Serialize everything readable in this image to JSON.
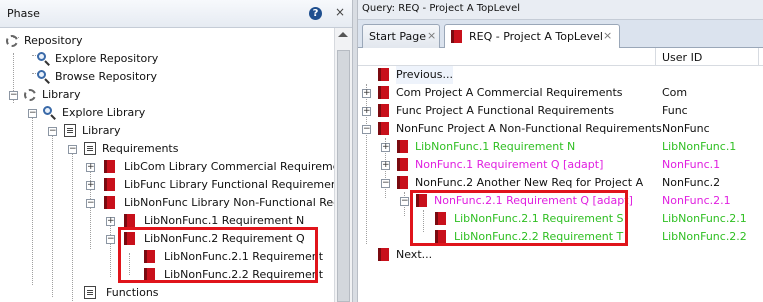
{
  "left_panel": {
    "title": "Phase",
    "help_icon": "?",
    "close_icon": "×",
    "tree": {
      "repository": "Repository",
      "explore_repository": "Explore Repository",
      "browse_repository": "Browse Repository",
      "library": "Library",
      "explore_library": "Explore Library",
      "library_doc": "Library",
      "requirements": "Requirements",
      "libcom": "LibCom Library Commercial Requirements",
      "libfunc": "LibFunc Library Functional Requirements",
      "libnonfunc": "LibNonFunc Library Non-Functional Requ",
      "libnonfunc1": "LibNonFunc.1 Requirement N",
      "libnonfunc2": "LibNonFunc.2 Requirement Q",
      "libnonfunc21": "LibNonFunc.2.1 Requirement",
      "libnonfunc22": "LibNonFunc.2.2 Requirement",
      "functions": "Functions"
    }
  },
  "right_panel": {
    "query_title": "Query: REQ - Project A TopLevel",
    "tabs": [
      {
        "label": "Start Page",
        "close": "×"
      },
      {
        "label": "REQ - Project A TopLevel",
        "close": "×"
      }
    ],
    "columns": {
      "user_id": "User ID"
    },
    "rows": [
      {
        "name": "Previous...",
        "uid": ""
      },
      {
        "name": "Com Project A Commercial Requirements",
        "uid": "Com"
      },
      {
        "name": "Func Project A Functional Requirements",
        "uid": "Func"
      },
      {
        "name": "NonFunc Project A Non-Functional Requirements",
        "uid": "NonFunc"
      },
      {
        "name": "LibNonFunc.1 Requirement N",
        "uid": "LibNonFunc.1"
      },
      {
        "name": "NonFunc.1 Requirement Q [adapt]",
        "uid": "NonFunc.1"
      },
      {
        "name": "NonFunc.2 Another New Req for Project A",
        "uid": "NonFunc.2"
      },
      {
        "name": "NonFunc.2.1 Requirement Q [adapt]",
        "uid": "NonFunc.2.1"
      },
      {
        "name": "LibNonFunc.2.1 Requirement S",
        "uid": "LibNonFunc.2.1"
      },
      {
        "name": "LibNonFunc.2.2 Requirement T",
        "uid": "LibNonFunc.2.2"
      },
      {
        "name": "Next...",
        "uid": ""
      }
    ]
  },
  "colors": {
    "link_green": "#2fbf22",
    "adapt_magenta": "#e020e0",
    "highlight_red": "#e0141b",
    "doc_red": "#c8101b"
  }
}
